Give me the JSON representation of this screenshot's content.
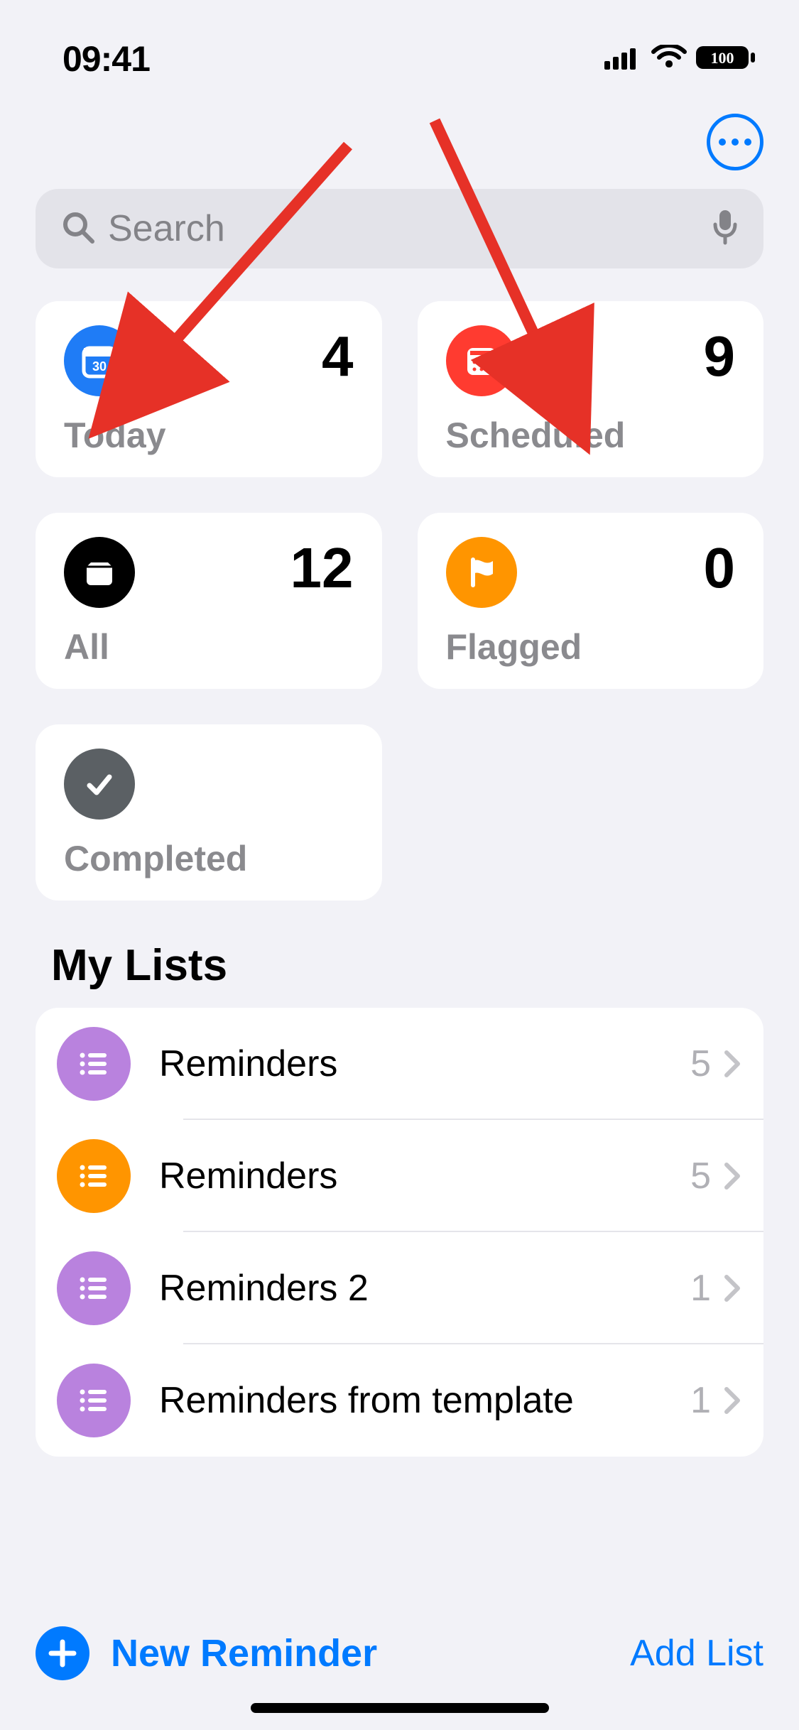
{
  "status": {
    "time": "09:41",
    "battery": "100"
  },
  "search": {
    "placeholder": "Search"
  },
  "cards": {
    "today": {
      "label": "Today",
      "count": "4",
      "color": "#1f7cf6"
    },
    "scheduled": {
      "label": "Scheduled",
      "count": "9",
      "color": "#ff3b30"
    },
    "all": {
      "label": "All",
      "count": "12",
      "color": "#000000"
    },
    "flagged": {
      "label": "Flagged",
      "count": "0",
      "color": "#ff9500"
    },
    "completed": {
      "label": "Completed",
      "color": "#5b6064"
    }
  },
  "section_title": "My Lists",
  "lists": [
    {
      "name": "Reminders",
      "count": "5",
      "color": "#b982de"
    },
    {
      "name": "Reminders",
      "count": "5",
      "color": "#ff9500"
    },
    {
      "name": "Reminders 2",
      "count": "1",
      "color": "#b982de"
    },
    {
      "name": "Reminders from template",
      "count": "1",
      "color": "#b982de"
    }
  ],
  "bottom": {
    "new_reminder": "New Reminder",
    "add_list": "Add List"
  }
}
